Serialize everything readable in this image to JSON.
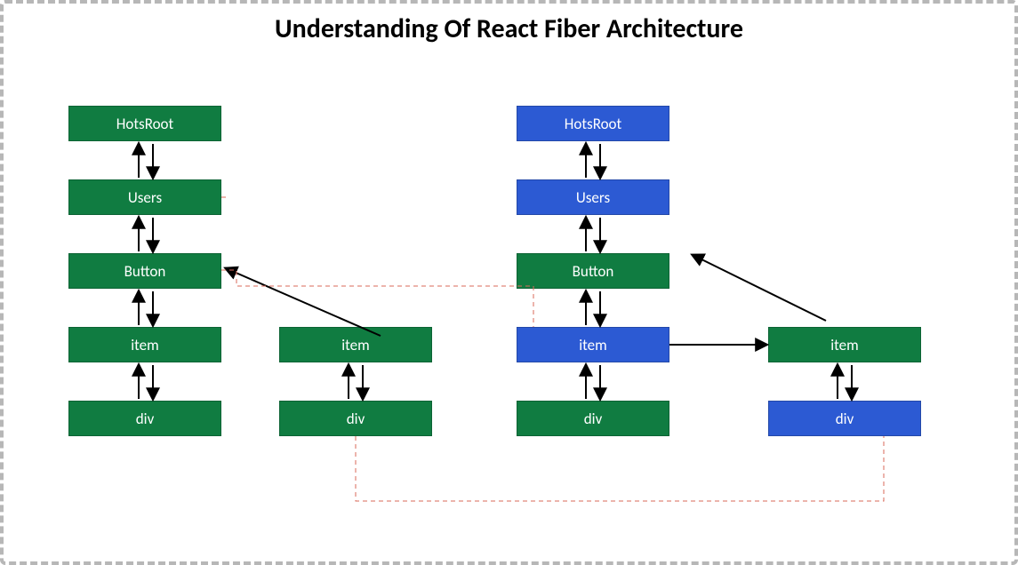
{
  "title": "Understanding Of React Fiber Architecture",
  "colors": {
    "green": "#107c41",
    "blue": "#2c5ad3",
    "redDash": "#d96a5a"
  },
  "left": {
    "col1": [
      "HotsRoot",
      "Users",
      "Button",
      "item",
      "div"
    ],
    "col2": [
      "item",
      "div"
    ]
  },
  "right": {
    "col1": [
      "HotsRoot",
      "Users",
      "Button",
      "item",
      "div"
    ],
    "col2": [
      "item",
      "div"
    ]
  }
}
